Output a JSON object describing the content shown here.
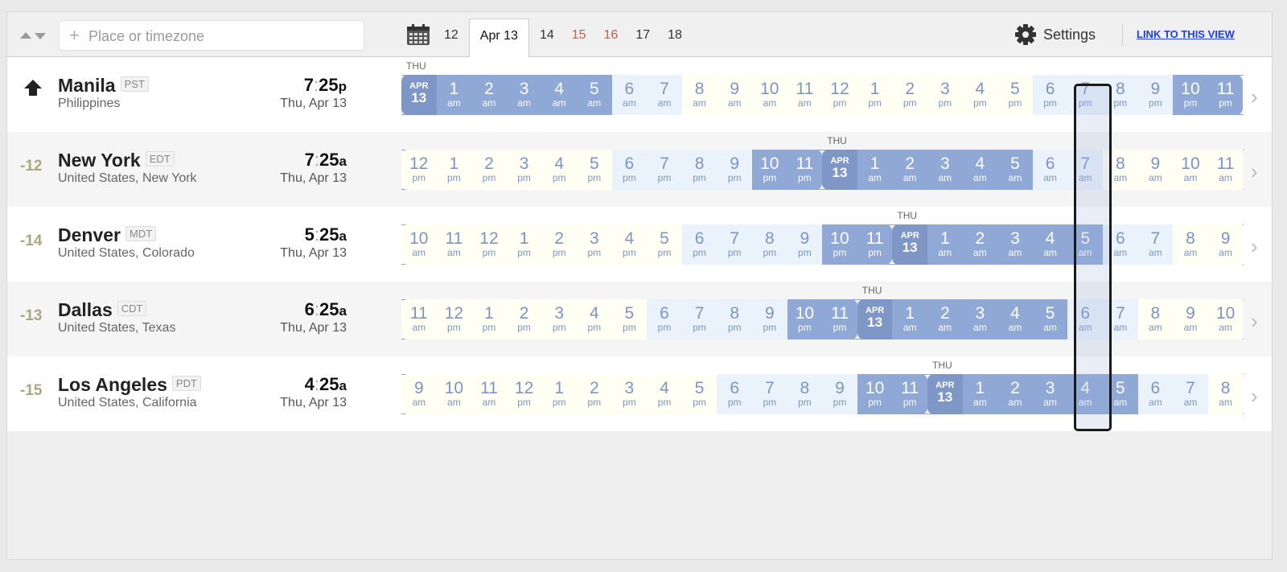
{
  "toolbar": {
    "search_placeholder": "Place or timezone",
    "search_plus": "+",
    "days": [
      {
        "label": "12",
        "type": "normal",
        "active": false
      },
      {
        "label": "Apr 13",
        "type": "normal",
        "active": true
      },
      {
        "label": "14",
        "type": "normal",
        "active": false
      },
      {
        "label": "15",
        "type": "weekend",
        "active": false
      },
      {
        "label": "16",
        "type": "weekend",
        "active": false
      },
      {
        "label": "17",
        "type": "normal",
        "active": false
      },
      {
        "label": "18",
        "type": "normal",
        "active": false
      }
    ],
    "settings_label": "Settings",
    "link_label": "LINK TO THIS VIEW"
  },
  "colors": {
    "night": "#8fa8d6",
    "date_cell": "#7f97c6",
    "morning": "#eaf3fb",
    "day": "#fffff3",
    "hour_text": "#7c95c4",
    "weekend": "#d9534f",
    "link": "#1a3ee0",
    "offset": "#a8a881"
  },
  "rows": [
    {
      "home": true,
      "offset": "",
      "city": "Manila",
      "abbr": "PST",
      "region": "Philippines",
      "hour": "7",
      "minute": "25",
      "ampm": "p",
      "date": "Thu, Apr 13",
      "dayname": "THU",
      "date_index": 0,
      "cells": [
        {
          "h": "APR",
          "m": "13",
          "t": "date"
        },
        {
          "h": "1",
          "m": "am",
          "t": "night"
        },
        {
          "h": "2",
          "m": "am",
          "t": "night"
        },
        {
          "h": "3",
          "m": "am",
          "t": "night"
        },
        {
          "h": "4",
          "m": "am",
          "t": "night"
        },
        {
          "h": "5",
          "m": "am",
          "t": "night"
        },
        {
          "h": "6",
          "m": "am",
          "t": "morn"
        },
        {
          "h": "7",
          "m": "am",
          "t": "morn"
        },
        {
          "h": "8",
          "m": "am",
          "t": "day"
        },
        {
          "h": "9",
          "m": "am",
          "t": "day"
        },
        {
          "h": "10",
          "m": "am",
          "t": "day"
        },
        {
          "h": "11",
          "m": "am",
          "t": "day"
        },
        {
          "h": "12",
          "m": "pm",
          "t": "day"
        },
        {
          "h": "1",
          "m": "pm",
          "t": "day"
        },
        {
          "h": "2",
          "m": "pm",
          "t": "day"
        },
        {
          "h": "3",
          "m": "pm",
          "t": "day"
        },
        {
          "h": "4",
          "m": "pm",
          "t": "day"
        },
        {
          "h": "5",
          "m": "pm",
          "t": "day"
        },
        {
          "h": "6",
          "m": "pm",
          "t": "morn"
        },
        {
          "h": "7",
          "m": "pm",
          "t": "morn"
        },
        {
          "h": "8",
          "m": "pm",
          "t": "morn"
        },
        {
          "h": "9",
          "m": "pm",
          "t": "morn"
        },
        {
          "h": "10",
          "m": "pm",
          "t": "night"
        },
        {
          "h": "11",
          "m": "pm",
          "t": "night"
        }
      ]
    },
    {
      "home": false,
      "offset": "-12",
      "city": "New York",
      "abbr": "EDT",
      "region": "United States, New York",
      "hour": "7",
      "minute": "25",
      "ampm": "a",
      "date": "Thu, Apr 13",
      "dayname": "THU",
      "date_index": 12,
      "cells": [
        {
          "h": "12",
          "m": "pm",
          "t": "day"
        },
        {
          "h": "1",
          "m": "pm",
          "t": "day"
        },
        {
          "h": "2",
          "m": "pm",
          "t": "day"
        },
        {
          "h": "3",
          "m": "pm",
          "t": "day"
        },
        {
          "h": "4",
          "m": "pm",
          "t": "day"
        },
        {
          "h": "5",
          "m": "pm",
          "t": "day"
        },
        {
          "h": "6",
          "m": "pm",
          "t": "morn"
        },
        {
          "h": "7",
          "m": "pm",
          "t": "morn"
        },
        {
          "h": "8",
          "m": "pm",
          "t": "morn"
        },
        {
          "h": "9",
          "m": "pm",
          "t": "morn"
        },
        {
          "h": "10",
          "m": "pm",
          "t": "night"
        },
        {
          "h": "11",
          "m": "pm",
          "t": "night"
        },
        {
          "h": "APR",
          "m": "13",
          "t": "date"
        },
        {
          "h": "1",
          "m": "am",
          "t": "night"
        },
        {
          "h": "2",
          "m": "am",
          "t": "night"
        },
        {
          "h": "3",
          "m": "am",
          "t": "night"
        },
        {
          "h": "4",
          "m": "am",
          "t": "night"
        },
        {
          "h": "5",
          "m": "am",
          "t": "night"
        },
        {
          "h": "6",
          "m": "am",
          "t": "morn"
        },
        {
          "h": "7",
          "m": "am",
          "t": "morn"
        },
        {
          "h": "8",
          "m": "am",
          "t": "day"
        },
        {
          "h": "9",
          "m": "am",
          "t": "day"
        },
        {
          "h": "10",
          "m": "am",
          "t": "day"
        },
        {
          "h": "11",
          "m": "am",
          "t": "day"
        }
      ]
    },
    {
      "home": false,
      "offset": "-14",
      "city": "Denver",
      "abbr": "MDT",
      "region": "United States, Colorado",
      "hour": "5",
      "minute": "25",
      "ampm": "a",
      "date": "Thu, Apr 13",
      "dayname": "THU",
      "date_index": 14,
      "cells": [
        {
          "h": "10",
          "m": "am",
          "t": "day"
        },
        {
          "h": "11",
          "m": "am",
          "t": "day"
        },
        {
          "h": "12",
          "m": "pm",
          "t": "day"
        },
        {
          "h": "1",
          "m": "pm",
          "t": "day"
        },
        {
          "h": "2",
          "m": "pm",
          "t": "day"
        },
        {
          "h": "3",
          "m": "pm",
          "t": "day"
        },
        {
          "h": "4",
          "m": "pm",
          "t": "day"
        },
        {
          "h": "5",
          "m": "pm",
          "t": "day"
        },
        {
          "h": "6",
          "m": "pm",
          "t": "morn"
        },
        {
          "h": "7",
          "m": "pm",
          "t": "morn"
        },
        {
          "h": "8",
          "m": "pm",
          "t": "morn"
        },
        {
          "h": "9",
          "m": "pm",
          "t": "morn"
        },
        {
          "h": "10",
          "m": "pm",
          "t": "night"
        },
        {
          "h": "11",
          "m": "pm",
          "t": "night"
        },
        {
          "h": "APR",
          "m": "13",
          "t": "date"
        },
        {
          "h": "1",
          "m": "am",
          "t": "night"
        },
        {
          "h": "2",
          "m": "am",
          "t": "night"
        },
        {
          "h": "3",
          "m": "am",
          "t": "night"
        },
        {
          "h": "4",
          "m": "am",
          "t": "night"
        },
        {
          "h": "5",
          "m": "am",
          "t": "night"
        },
        {
          "h": "6",
          "m": "am",
          "t": "morn"
        },
        {
          "h": "7",
          "m": "am",
          "t": "morn"
        },
        {
          "h": "8",
          "m": "am",
          "t": "day"
        },
        {
          "h": "9",
          "m": "am",
          "t": "day"
        }
      ]
    },
    {
      "home": false,
      "offset": "-13",
      "city": "Dallas",
      "abbr": "CDT",
      "region": "United States, Texas",
      "hour": "6",
      "minute": "25",
      "ampm": "a",
      "date": "Thu, Apr 13",
      "dayname": "THU",
      "date_index": 13,
      "cells": [
        {
          "h": "11",
          "m": "am",
          "t": "day"
        },
        {
          "h": "12",
          "m": "pm",
          "t": "day"
        },
        {
          "h": "1",
          "m": "pm",
          "t": "day"
        },
        {
          "h": "2",
          "m": "pm",
          "t": "day"
        },
        {
          "h": "3",
          "m": "pm",
          "t": "day"
        },
        {
          "h": "4",
          "m": "pm",
          "t": "day"
        },
        {
          "h": "5",
          "m": "pm",
          "t": "day"
        },
        {
          "h": "6",
          "m": "pm",
          "t": "morn"
        },
        {
          "h": "7",
          "m": "pm",
          "t": "morn"
        },
        {
          "h": "8",
          "m": "pm",
          "t": "morn"
        },
        {
          "h": "9",
          "m": "pm",
          "t": "morn"
        },
        {
          "h": "10",
          "m": "pm",
          "t": "night"
        },
        {
          "h": "11",
          "m": "pm",
          "t": "night"
        },
        {
          "h": "APR",
          "m": "13",
          "t": "date"
        },
        {
          "h": "1",
          "m": "am",
          "t": "night"
        },
        {
          "h": "2",
          "m": "am",
          "t": "night"
        },
        {
          "h": "3",
          "m": "am",
          "t": "night"
        },
        {
          "h": "4",
          "m": "am",
          "t": "night"
        },
        {
          "h": "5",
          "m": "am",
          "t": "night"
        },
        {
          "h": "6",
          "m": "am",
          "t": "morn"
        },
        {
          "h": "7",
          "m": "am",
          "t": "morn"
        },
        {
          "h": "8",
          "m": "am",
          "t": "day"
        },
        {
          "h": "9",
          "m": "am",
          "t": "day"
        },
        {
          "h": "10",
          "m": "am",
          "t": "day"
        }
      ]
    },
    {
      "home": false,
      "offset": "-15",
      "city": "Los Angeles",
      "abbr": "PDT",
      "region": "United States, California",
      "hour": "4",
      "minute": "25",
      "ampm": "a",
      "date": "Thu, Apr 13",
      "dayname": "THU",
      "date_index": 15,
      "cells": [
        {
          "h": "9",
          "m": "am",
          "t": "day"
        },
        {
          "h": "10",
          "m": "am",
          "t": "day"
        },
        {
          "h": "11",
          "m": "am",
          "t": "day"
        },
        {
          "h": "12",
          "m": "pm",
          "t": "day"
        },
        {
          "h": "1",
          "m": "pm",
          "t": "day"
        },
        {
          "h": "2",
          "m": "pm",
          "t": "day"
        },
        {
          "h": "3",
          "m": "pm",
          "t": "day"
        },
        {
          "h": "4",
          "m": "pm",
          "t": "day"
        },
        {
          "h": "5",
          "m": "pm",
          "t": "day"
        },
        {
          "h": "6",
          "m": "pm",
          "t": "morn"
        },
        {
          "h": "7",
          "m": "pm",
          "t": "morn"
        },
        {
          "h": "8",
          "m": "pm",
          "t": "morn"
        },
        {
          "h": "9",
          "m": "pm",
          "t": "morn"
        },
        {
          "h": "10",
          "m": "pm",
          "t": "night"
        },
        {
          "h": "11",
          "m": "pm",
          "t": "night"
        },
        {
          "h": "APR",
          "m": "13",
          "t": "date"
        },
        {
          "h": "1",
          "m": "am",
          "t": "night"
        },
        {
          "h": "2",
          "m": "am",
          "t": "night"
        },
        {
          "h": "3",
          "m": "am",
          "t": "night"
        },
        {
          "h": "4",
          "m": "am",
          "t": "night"
        },
        {
          "h": "5",
          "m": "am",
          "t": "night"
        },
        {
          "h": "6",
          "m": "am",
          "t": "morn"
        },
        {
          "h": "7",
          "m": "am",
          "t": "morn"
        },
        {
          "h": "8",
          "m": "am",
          "t": "day"
        }
      ]
    }
  ]
}
